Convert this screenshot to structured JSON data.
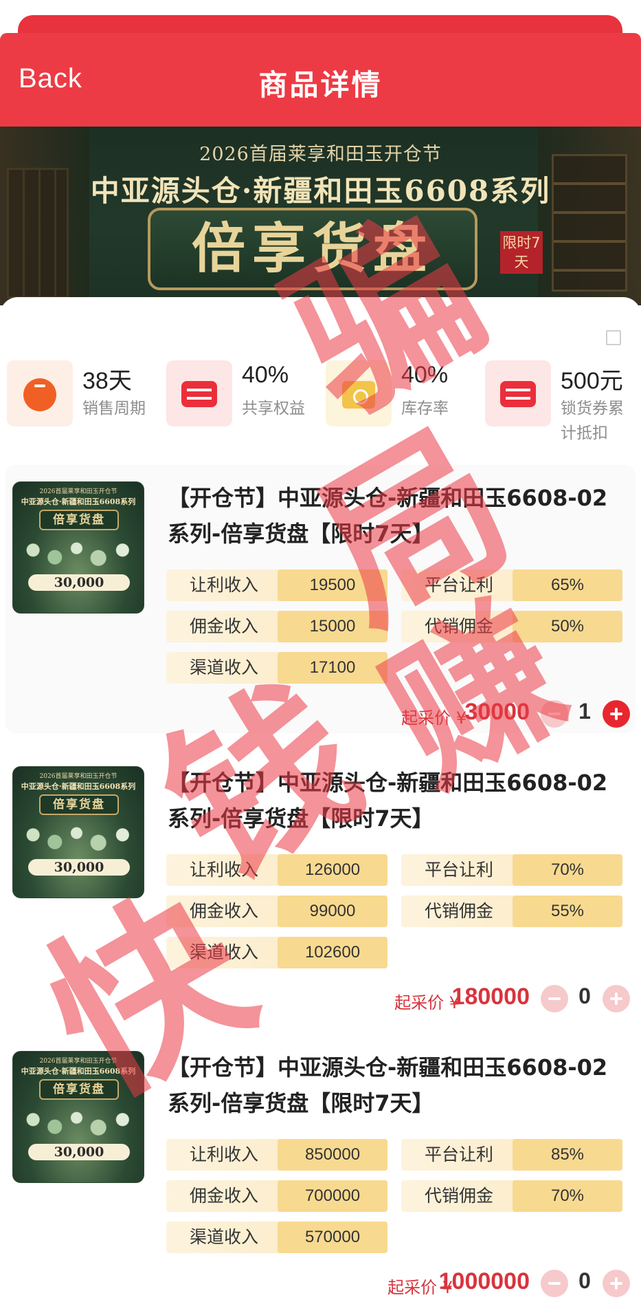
{
  "header": {
    "back_label": "Back",
    "title": "商品详情"
  },
  "banner": {
    "line1": "2026首届莱享和田玉开仓节",
    "line2": "中亚源头仓·新疆和田玉6608系列",
    "main": "倍享货盘",
    "badge": "限时7天"
  },
  "stats": [
    {
      "value": "38天",
      "label": "销售周期",
      "icon": "timer-icon",
      "color": "#f06025"
    },
    {
      "value": "40%",
      "label": "共享权益",
      "icon": "briefcase-icon",
      "color": "#ea2f3b"
    },
    {
      "value": "40%",
      "label": "库存率",
      "icon": "inventory-box-icon",
      "color": "#f2c44a"
    },
    {
      "value": "500元",
      "label": "锁货券累计抵扣",
      "icon": "coupon-icon",
      "color": "#ea2f3b"
    }
  ],
  "products": [
    {
      "title": "【开仓节】中亚源头仓-新疆和田玉6608-02系列-倍享货盘【限时7天】",
      "thumb": {
        "line1": "2026首届莱享和田玉开仓节",
        "line2": "中亚源头仓·新疆和田玉6608系列",
        "main": "倍享货盘",
        "price": "30,000"
      },
      "metrics": {
        "rangli_label": "让利收入",
        "rangli_value": "19500",
        "yongjin_label": "佣金收入",
        "yongjin_value": "15000",
        "qudao_label": "渠道收入",
        "qudao_value": "17100",
        "pingtai_label": "平台让利",
        "pingtai_value": "65%",
        "daixiao_label": "代销佣金",
        "daixiao_value": "50%"
      },
      "price_label": "起采价 ¥",
      "price_value": "30000",
      "quantity": "1"
    },
    {
      "title": "【开仓节】中亚源头仓-新疆和田玉6608-02系列-倍享货盘【限时7天】",
      "thumb": {
        "line1": "2026首届莱享和田玉开仓节",
        "line2": "中亚源头仓·新疆和田玉6608系列",
        "main": "倍享货盘",
        "price": "30,000"
      },
      "metrics": {
        "rangli_label": "让利收入",
        "rangli_value": "126000",
        "yongjin_label": "佣金收入",
        "yongjin_value": "99000",
        "qudao_label": "渠道收入",
        "qudao_value": "102600",
        "pingtai_label": "平台让利",
        "pingtai_value": "70%",
        "daixiao_label": "代销佣金",
        "daixiao_value": "55%"
      },
      "price_label": "起采价 ¥",
      "price_value": "180000",
      "quantity": "0"
    },
    {
      "title": "【开仓节】中亚源头仓-新疆和田玉6608-02系列-倍享货盘【限时7天】",
      "thumb": {
        "line1": "2026首届莱享和田玉开仓节",
        "line2": "中亚源头仓·新疆和田玉6608系列",
        "main": "倍享货盘",
        "price": "30,000"
      },
      "metrics": {
        "rangli_label": "让利收入",
        "rangli_value": "850000",
        "yongjin_label": "佣金收入",
        "yongjin_value": "700000",
        "qudao_label": "渠道收入",
        "qudao_value": "570000",
        "pingtai_label": "平台让利",
        "pingtai_value": "85%",
        "daixiao_label": "代销佣金",
        "daixiao_value": "70%"
      },
      "price_label": "起采价 ¥",
      "price_value": "1000000",
      "quantity": "0"
    }
  ],
  "watermark": {
    "chars": [
      "骗",
      "局",
      "赚",
      "钱",
      "快",
      "骗",
      "局",
      "快"
    ],
    "color": "#eb3a46"
  }
}
